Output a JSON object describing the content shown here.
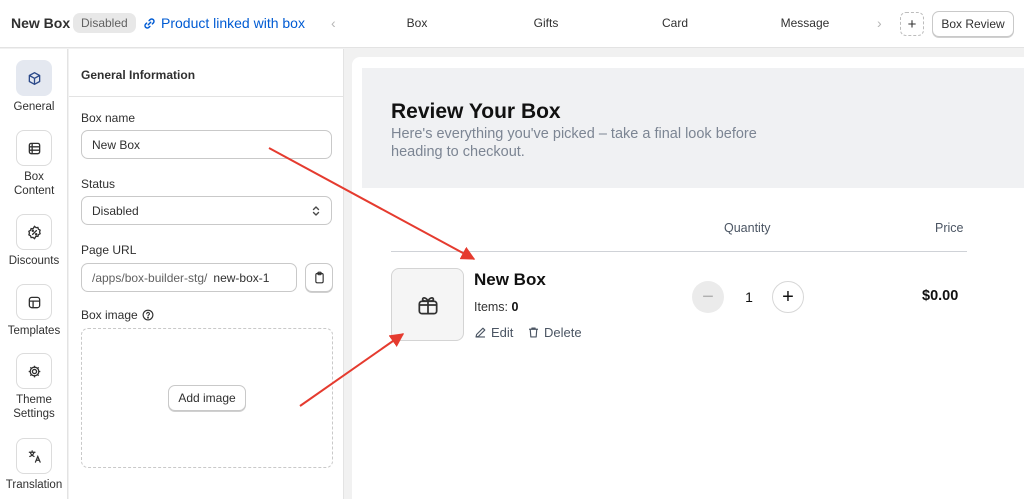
{
  "header": {
    "title": "New Box",
    "status_badge": "Disabled",
    "link_label": "Product linked with box",
    "prev_arrow": "‹",
    "next_arrow": "›",
    "tabs": [
      {
        "label": "Box"
      },
      {
        "label": "Gifts"
      },
      {
        "label": "Card"
      },
      {
        "label": "Message"
      }
    ],
    "add_tab_icon": "plus-icon",
    "add_tab_label": "+",
    "review_button": "Box Review"
  },
  "sidebar": {
    "items": [
      {
        "label": "General",
        "icon": "cube-icon",
        "active": true
      },
      {
        "label": "Box Content",
        "icon": "list-icon",
        "active": false
      },
      {
        "label": "Discounts",
        "icon": "discount-icon",
        "active": false
      },
      {
        "label": "Templates",
        "icon": "layout-icon",
        "active": false
      },
      {
        "label": "Theme Settings",
        "icon": "gear-icon",
        "active": false
      },
      {
        "label": "Translation",
        "icon": "translate-icon",
        "active": false
      }
    ]
  },
  "panel": {
    "title": "General Information",
    "box_name_label": "Box name",
    "box_name_value": "New Box",
    "status_label": "Status",
    "status_value": "Disabled",
    "page_url_label": "Page URL",
    "page_url_prefix": "/apps/box-builder-stg/",
    "page_url_value": "new-box-1",
    "box_image_label": "Box image",
    "add_image_button": "Add image"
  },
  "preview": {
    "title": "Review Your Box",
    "subtitle": "Here's everything you've picked – take a final look before heading to checkout.",
    "col_quantity": "Quantity",
    "col_price": "Price",
    "item": {
      "name": "New Box",
      "items_label": "Items:",
      "items_count": "0",
      "edit_label": "Edit",
      "delete_label": "Delete",
      "quantity": "1",
      "minus_label": "−",
      "plus_label": "+",
      "price": "$0.00"
    }
  },
  "colors": {
    "link": "#005bd3",
    "annotation_arrow": "#e53b2f",
    "banner_bg": "#f0f1f3"
  }
}
